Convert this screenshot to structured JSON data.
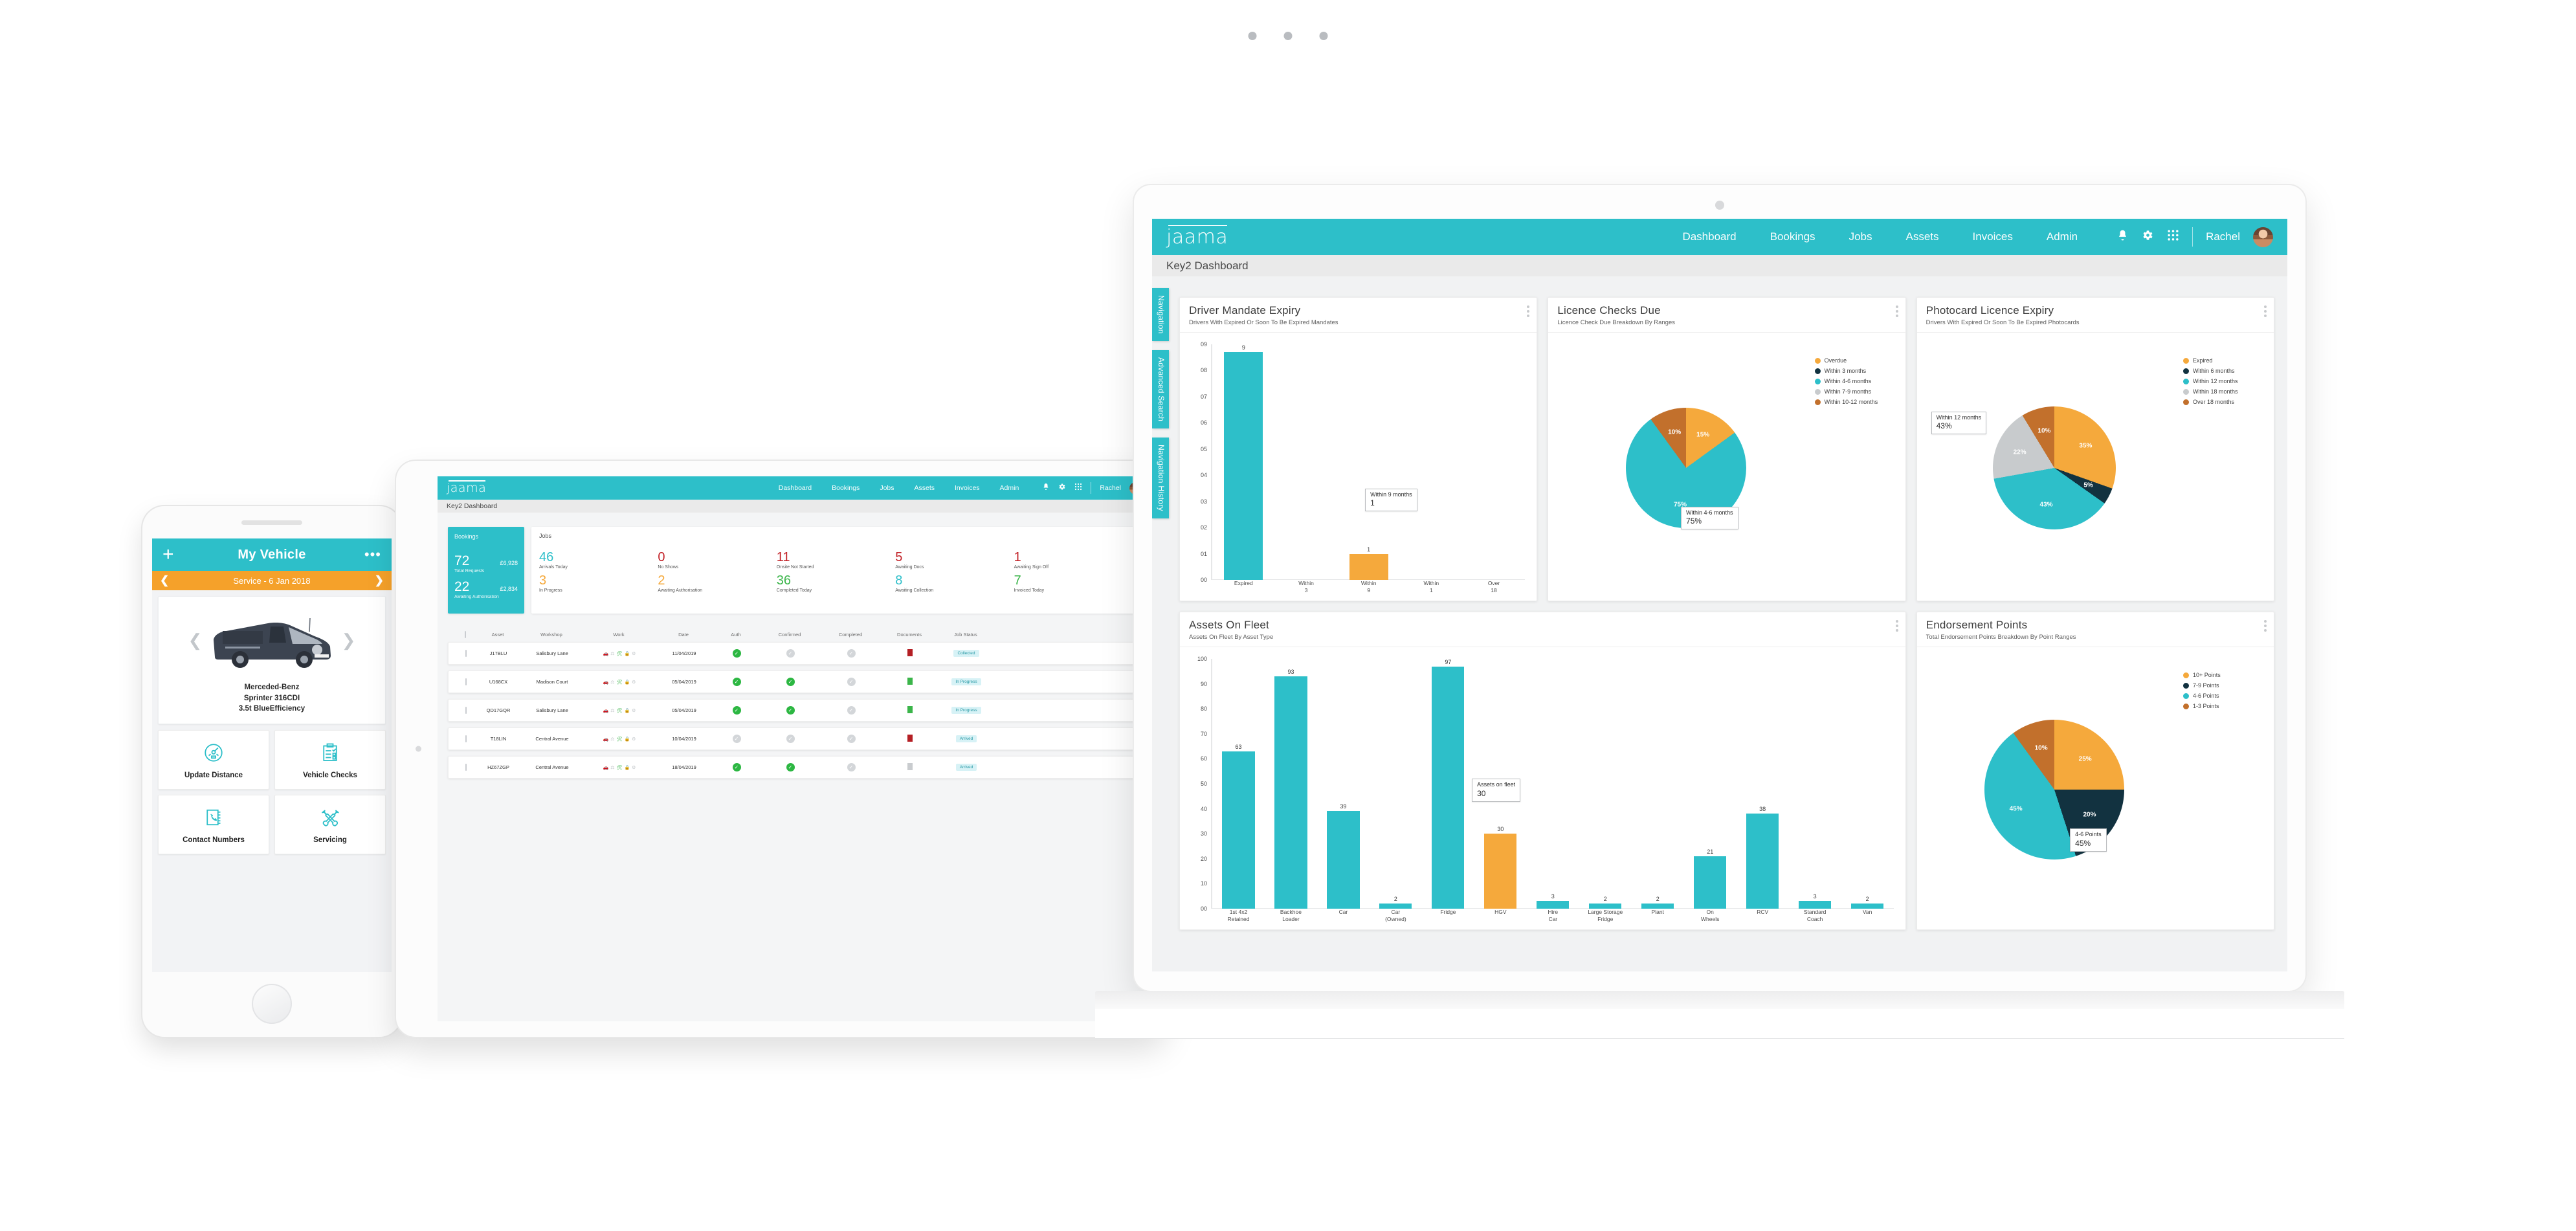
{
  "brand": {
    "logo": "jaama",
    "accent": "#2dbfc9",
    "orange": "#f5a93c",
    "dark": "#123240",
    "brown": "#c2702c",
    "grey": "#c8cbcd"
  },
  "topnav": {
    "items": [
      "Dashboard",
      "Bookings",
      "Jobs",
      "Assets",
      "Invoices",
      "Admin"
    ],
    "icons": [
      "bell-icon",
      "gear-icon",
      "apps-grid-icon"
    ],
    "user": "Rachel"
  },
  "page_title": "Key2 Dashboard",
  "laptop": {
    "sidetabs": [
      "Navigation",
      "Advanced Search",
      "Navigation History"
    ],
    "panels": [
      {
        "title": "Driver Mandate Expiry",
        "subtitle": "Drivers With Expired Or Soon To Be Expired Mandates"
      },
      {
        "title": "Licence Checks Due",
        "subtitle": "Licence Check Due Breakdown By Ranges"
      },
      {
        "title": "Photocard Licence Expiry",
        "subtitle": "Drivers With Expired Or Soon To Be Expired Photocards"
      },
      {
        "title": "Assets On Fleet",
        "subtitle": "Assets On Fleet By Asset Type"
      },
      {
        "title": "Endorsement Points",
        "subtitle": "Total Endorsement Points Breakdown By Point Ranges"
      }
    ]
  },
  "chart_data": [
    {
      "type": "bar",
      "title": "Driver Mandate Expiry",
      "subtitle": "Drivers With Expired Or Soon To Be Expired Mandates",
      "xlabel": "",
      "ylabel": "",
      "categories": [
        "Expired",
        "Within 3",
        "Within 9",
        "Within 1",
        "Over 18"
      ],
      "values": [
        9,
        0,
        1,
        0,
        0
      ],
      "colors": [
        "#2dbfc9",
        "#2dbfc9",
        "#f5a93c",
        "#2dbfc9",
        "#2dbfc9"
      ],
      "ytick_labels": [
        "09",
        "08",
        "07",
        "06",
        "05",
        "04",
        "03",
        "02",
        "01",
        "00"
      ],
      "ylim": [
        0,
        9
      ],
      "grid": false,
      "tooltip": {
        "label": "Within 9 months",
        "value": "1"
      }
    },
    {
      "type": "pie",
      "title": "Licence Checks Due",
      "subtitle": "Licence Check Due Breakdown By Ranges",
      "legend_position": "right",
      "categories": [
        "Overdue",
        "Within 3 months",
        "Within 4-6 months",
        "Within 7-9 months",
        "Within 10-12 months"
      ],
      "values": [
        15,
        0,
        75,
        0,
        10
      ],
      "colors": [
        "#f5a93c",
        "#123240",
        "#2dbfc9",
        "#c8cbcd",
        "#c2702c"
      ],
      "slice_labels": [
        "15%",
        "",
        "75%",
        "",
        "10%"
      ],
      "tooltip": {
        "label": "Within 4-6 months",
        "value": "75%"
      }
    },
    {
      "type": "pie",
      "title": "Photocard Licence Expiry",
      "subtitle": "Drivers With Expired Or Soon To Be Expired Photocards",
      "legend_position": "right",
      "categories": [
        "Expired",
        "Within 6 months",
        "Within 12 months",
        "Within 18 months",
        "Over 18 months"
      ],
      "values": [
        35,
        5,
        43,
        22,
        10
      ],
      "colors": [
        "#f5a93c",
        "#123240",
        "#2dbfc9",
        "#c8cbcd",
        "#c2702c"
      ],
      "slice_labels": [
        "35%",
        "5%",
        "43%",
        "22%",
        "10%"
      ],
      "tooltip": {
        "label": "Within 12 months",
        "value": "43%"
      }
    },
    {
      "type": "bar",
      "title": "Assets On Fleet",
      "subtitle": "Assets On Fleet By Asset Type",
      "xlabel": "",
      "ylabel": "",
      "categories": [
        "1st 4x2 Retained",
        "Backhoe Loader",
        "Car",
        "Car (Owned)",
        "Fridge",
        "HGV",
        "Hire Car",
        "Large Storage Fridge",
        "Plant",
        "On Wheels",
        "RCV",
        "Standard Coach",
        "Van"
      ],
      "values": [
        63,
        93,
        39,
        2,
        97,
        30,
        3,
        2,
        2,
        21,
        38,
        3,
        2
      ],
      "colors": [
        "#2dbfc9",
        "#2dbfc9",
        "#2dbfc9",
        "#2dbfc9",
        "#2dbfc9",
        "#f5a93c",
        "#2dbfc9",
        "#2dbfc9",
        "#2dbfc9",
        "#2dbfc9",
        "#2dbfc9",
        "#2dbfc9",
        "#2dbfc9"
      ],
      "ytick_labels": [
        "100",
        "90",
        "80",
        "70",
        "60",
        "50",
        "40",
        "30",
        "20",
        "10",
        "00"
      ],
      "ylim": [
        0,
        100
      ],
      "grid": false,
      "tooltip": {
        "label": "Assets on fleet",
        "value": "30"
      }
    },
    {
      "type": "pie",
      "title": "Endorsement Points",
      "subtitle": "Total Endorsement Points Breakdown By Point Ranges",
      "legend_position": "right",
      "categories": [
        "10+ Points",
        "7-9 Points",
        "4-6 Points",
        "1-3 Points"
      ],
      "values": [
        25,
        20,
        45,
        10
      ],
      "colors": [
        "#f5a93c",
        "#123240",
        "#2dbfc9",
        "#c2702c"
      ],
      "slice_labels": [
        "25%",
        "20%",
        "45%",
        "10%"
      ],
      "tooltip": {
        "label": "4-6 Points",
        "value": "45%"
      }
    }
  ],
  "tablet": {
    "bookings": {
      "heading": "Bookings",
      "rows": [
        {
          "count": "72",
          "amount": "£6,928",
          "label": "Total Requests"
        },
        {
          "count": "22",
          "amount": "£2,834",
          "label": "Awaiting Authorisation"
        }
      ]
    },
    "jobs": {
      "heading": "Jobs",
      "stats": [
        {
          "value": "46",
          "label": "Arrivals Today",
          "color": "#2dbfc9"
        },
        {
          "value": "0",
          "label": "No Shows",
          "color": "#c22026"
        },
        {
          "value": "11",
          "label": "Onsite Not Started",
          "color": "#c22026"
        },
        {
          "value": "5",
          "label": "Awaiting Docs",
          "color": "#c22026"
        },
        {
          "value": "1",
          "label": "Awaiting Sign Off",
          "color": "#c22026"
        },
        {
          "value": "3",
          "label": "In Progress",
          "color": "#f5a93c"
        },
        {
          "value": "2",
          "label": "Awaiting Authorisation",
          "color": "#f5a93c"
        },
        {
          "value": "36",
          "label": "Completed Today",
          "color": "#3bb54a"
        },
        {
          "value": "8",
          "label": "Awaiting Collection",
          "color": "#2dbfc9"
        },
        {
          "value": "7",
          "label": "Invoiced Today",
          "color": "#3bb54a"
        }
      ]
    },
    "table": {
      "columns": [
        "",
        "Asset",
        "Workshop",
        "Work",
        "Date",
        "Auth",
        "Confirmed",
        "Completed",
        "Documents",
        "Job Status"
      ],
      "rows": [
        {
          "asset": "J17BLU",
          "workshop": "Salisbury Lane",
          "date": "11/04/2019",
          "auth": "on",
          "confirmed": "off",
          "completed": "off",
          "doc": "#b41f24",
          "status": "Collected"
        },
        {
          "asset": "U168CX",
          "workshop": "Madison Court",
          "date": "05/04/2019",
          "auth": "on",
          "confirmed": "on",
          "completed": "off",
          "doc": "#3bb54a",
          "status": "In Progress"
        },
        {
          "asset": "QD17GQR",
          "workshop": "Salisbury Lane",
          "date": "05/04/2019",
          "auth": "on",
          "confirmed": "on",
          "completed": "off",
          "doc": "#3bb54a",
          "status": "In Progress"
        },
        {
          "asset": "T18LIN",
          "workshop": "Central Avenue",
          "date": "10/04/2019",
          "auth": "off",
          "confirmed": "off",
          "completed": "off",
          "doc": "#b41f24",
          "status": "Arrived"
        },
        {
          "asset": "HZ67ZGP",
          "workshop": "Central Avenue",
          "date": "18/04/2019",
          "auth": "on",
          "confirmed": "on",
          "completed": "off",
          "doc": "#c9cccf",
          "status": "Arrived"
        }
      ]
    }
  },
  "phone": {
    "title": "My Vehicle",
    "add_label": "+",
    "more_label": "•••",
    "service_banner": "Service - 6 Jan 2018",
    "vehicle_name": "Merceded-Benz\nSprinter 316CDI\n3.5t BlueEfficiency",
    "tiles": [
      {
        "label": "Update Distance",
        "icon": "speedometer-icon"
      },
      {
        "label": "Vehicle Checks",
        "icon": "clipboard-check-icon"
      },
      {
        "label": "Contact Numbers",
        "icon": "phone-book-icon"
      },
      {
        "label": "Servicing",
        "icon": "crossed-tools-icon"
      }
    ]
  }
}
